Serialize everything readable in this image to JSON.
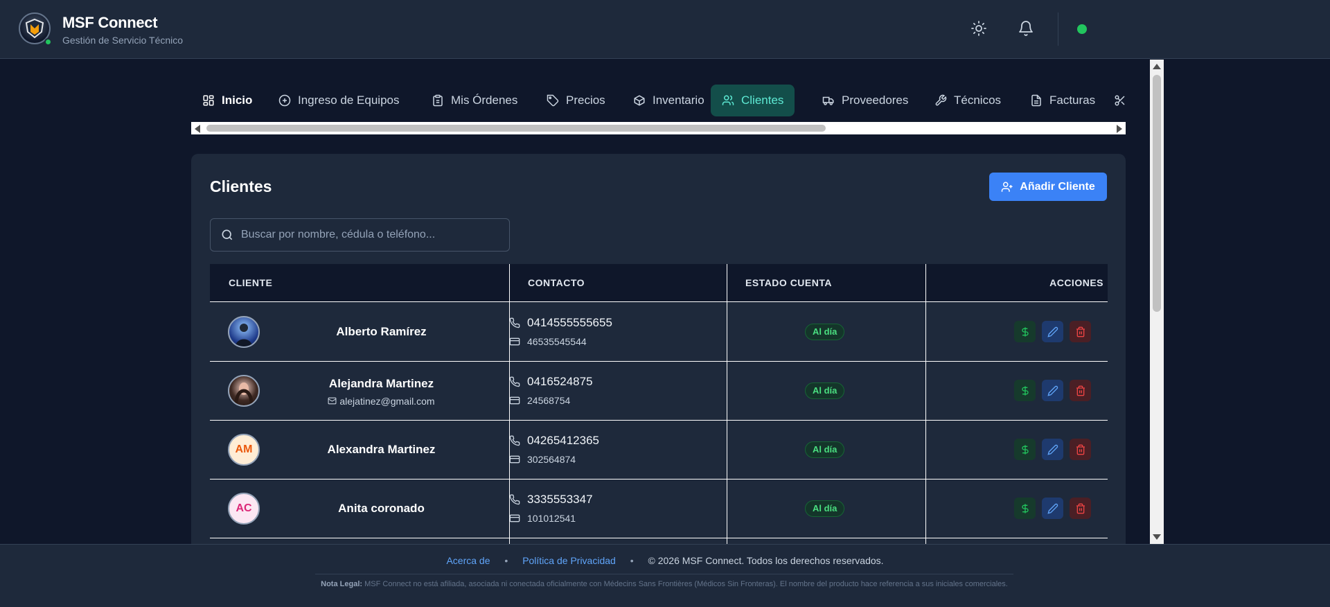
{
  "header": {
    "title": "MSF Connect",
    "subtitle": "Gestión de Servicio Técnico",
    "logo_text": "MSF",
    "icons": [
      "sun-icon",
      "bell-icon"
    ],
    "status_color": "#22c55e"
  },
  "nav": {
    "tabs": [
      {
        "label": "Inicio",
        "icon": "dashboard-icon"
      },
      {
        "label": "Ingreso de Equipos",
        "icon": "plus-circle-icon"
      },
      {
        "label": "Mis Órdenes",
        "icon": "clipboard-icon"
      },
      {
        "label": "Precios",
        "icon": "tag-icon"
      },
      {
        "label": "Inventario",
        "icon": "box-icon"
      },
      {
        "label": "Clientes",
        "icon": "users-icon",
        "active": true
      },
      {
        "label": "Proveedores",
        "icon": "truck-icon"
      },
      {
        "label": "Técnicos",
        "icon": "wrench-icon"
      },
      {
        "label": "Facturas",
        "icon": "file-icon"
      },
      {
        "label": "",
        "icon": "scissors-icon"
      }
    ]
  },
  "clients": {
    "title": "Clientes",
    "add_button": "Añadir Cliente",
    "search_placeholder": "Buscar por nombre, cédula o teléfono...",
    "columns": [
      "CLIENTE",
      "CONTACTO",
      "ESTADO CUENTA",
      "ACCIONES"
    ],
    "rows": [
      {
        "name": "Alberto Ramírez",
        "email": "",
        "phone": "0414555555655",
        "id": "46535545544",
        "status": "Al día",
        "avatar": "photo"
      },
      {
        "name": "Alejandra Martinez",
        "email": "alejatinez@gmail.com",
        "phone": "0416524875",
        "id": "24568754",
        "status": "Al día",
        "avatar": "photo"
      },
      {
        "name": "Alexandra Martinez",
        "email": "",
        "phone": "04265412365",
        "id": "302564874",
        "status": "Al día",
        "avatar": "AM"
      },
      {
        "name": "Anita coronado",
        "email": "",
        "phone": "3335553347",
        "id": "101012541",
        "status": "Al día",
        "avatar": "AC"
      }
    ],
    "colors": {
      "am_bg": "#ffedd5",
      "am_fg": "#ea580c",
      "ac_bg": "#fce7f3",
      "ac_fg": "#db2777",
      "ok": "#4ade80"
    }
  },
  "footer": {
    "about": "Acerca de",
    "privacy": "Política de Privacidad",
    "copyright": "© 2026 MSF Connect. Todos los derechos reservados.",
    "legal_label": "Nota Legal:",
    "legal_text": "MSF Connect no está afiliada, asociada ni conectada oficialmente con Médecins Sans Frontières (Médicos Sin Fronteras). El nombre del producto hace referencia a sus iniciales comerciales."
  }
}
